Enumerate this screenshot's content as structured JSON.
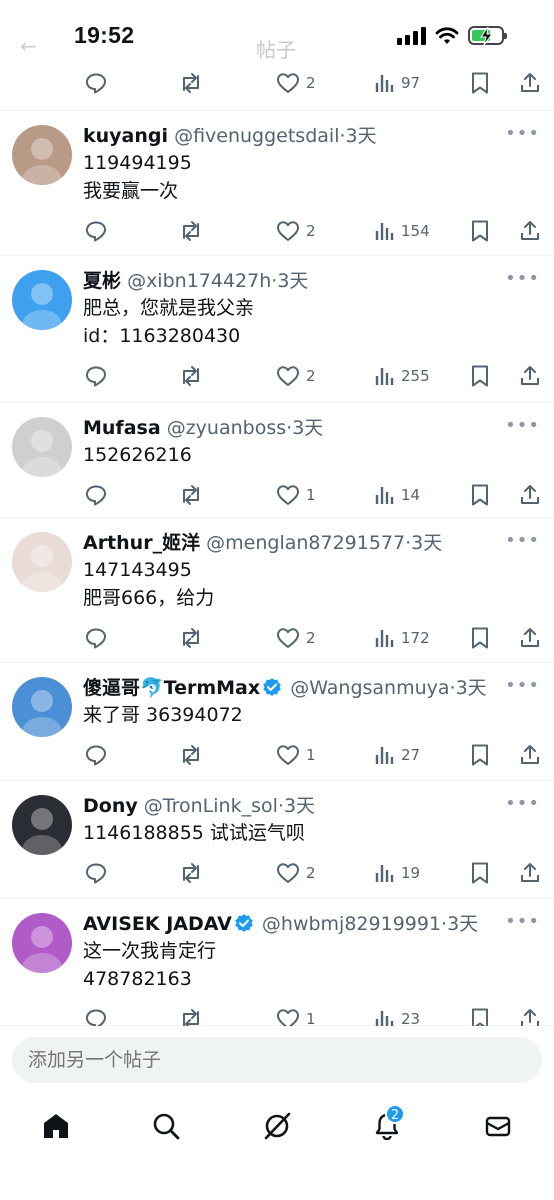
{
  "status_bar": {
    "time": "19:52",
    "header_title": "帖子"
  },
  "top_actions": {
    "likes": "2",
    "views": "97"
  },
  "posts": [
    {
      "name": "kuyangi",
      "handle": "@fivenuggetsdail",
      "time": "3天",
      "lines": [
        "119494195",
        "我要赢一次"
      ],
      "likes": "2",
      "views": "154",
      "verified": false,
      "avatar_color": "#b89a86"
    },
    {
      "name": "夏彬",
      "handle": "@xibn174427h",
      "time": "3天",
      "lines": [
        "肥总，您就是我父亲",
        "id：1163280430"
      ],
      "likes": "2",
      "views": "255",
      "verified": false,
      "avatar_color": "#3fa0f0"
    },
    {
      "name": "Mufasa",
      "handle": "@zyuanboss",
      "time": "3天",
      "lines": [
        "152626216"
      ],
      "likes": "1",
      "views": "14",
      "verified": false,
      "avatar_color": "#cfcfcf"
    },
    {
      "name": "Arthur_姬洋",
      "handle": "@menglan87291577",
      "time": "3天",
      "lines": [
        "147143495",
        "肥哥666，给力"
      ],
      "likes": "2",
      "views": "172",
      "verified": false,
      "avatar_color": "#e9dcd6"
    },
    {
      "name": "傻逼哥🐬TermMax",
      "handle": "@Wangsanmuya",
      "time": "3天",
      "lines": [
        "来了哥 36394072"
      ],
      "likes": "1",
      "views": "27",
      "verified": true,
      "avatar_color": "#4b8fd6"
    },
    {
      "name": "Dony",
      "handle": "@TronLink_sol",
      "time": "3天",
      "lines": [
        "1146188855 试试运气呗"
      ],
      "likes": "2",
      "views": "19",
      "verified": false,
      "avatar_color": "#2a2d33"
    },
    {
      "name": "AVISEK JADAV",
      "handle": "@hwbmj82919991",
      "time": "3天",
      "lines": [
        "这一次我肯定行",
        "478782163"
      ],
      "likes": "1",
      "views": "23",
      "verified": true,
      "avatar_color": "#b05bc7"
    }
  ],
  "compose": {
    "placeholder": "添加另一个帖子"
  },
  "nav": {
    "items": [
      {
        "icon": "home-icon"
      },
      {
        "icon": "search-icon"
      },
      {
        "icon": "grok-icon"
      },
      {
        "icon": "bell-icon",
        "badge": "2"
      },
      {
        "icon": "mail-icon"
      }
    ]
  },
  "colors": {
    "accent": "#1d9bf0",
    "text": "#0f1419",
    "muted": "#536471",
    "divider": "#eff3f4"
  }
}
